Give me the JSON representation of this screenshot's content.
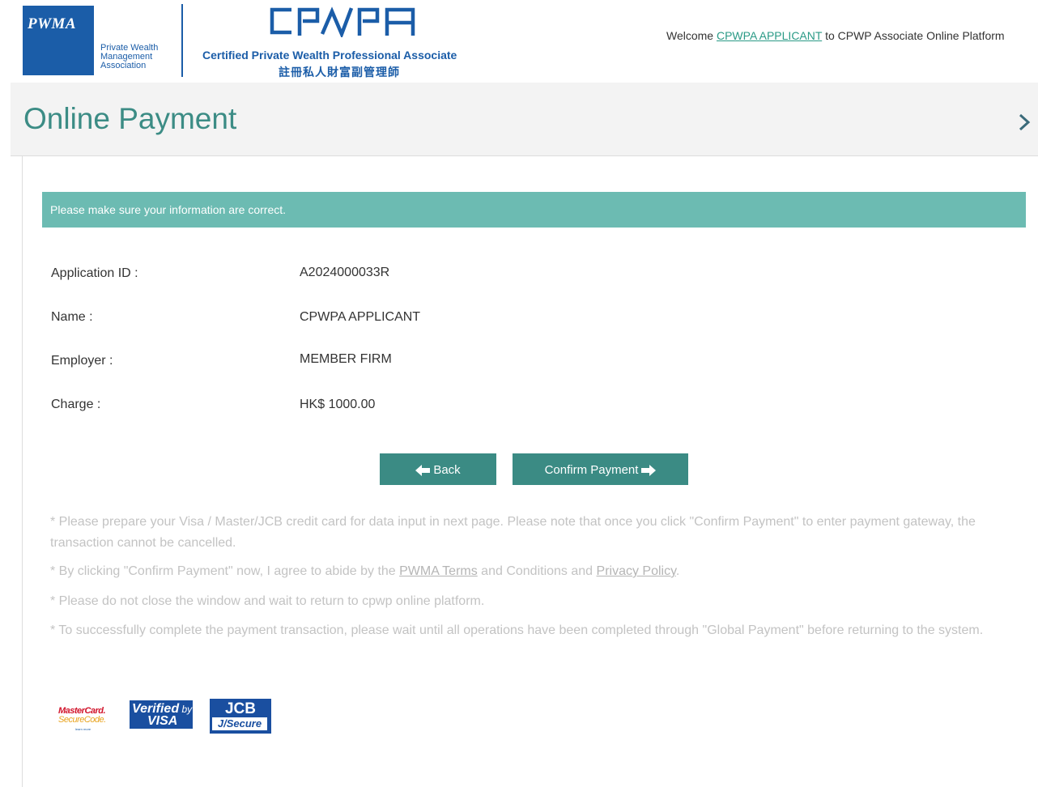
{
  "header": {
    "pwma_logo_text": "PWMA",
    "pwma_sub_1": "Private Wealth",
    "pwma_sub_2": "Management",
    "pwma_sub_3": "Association",
    "cpwpa_logo_text": "CPWPA",
    "cpwpa_title": "Certified Private Wealth Professional Associate",
    "cpwpa_chinese": "註冊私人財富副管理師",
    "welcome_prefix": "Welcome ",
    "welcome_user": "CPWPA APPLICANT",
    "welcome_suffix": " to CPWP Associate Online Platform"
  },
  "page": {
    "title": "Online Payment",
    "notice": "Please make sure your information are correct."
  },
  "details": [
    {
      "label": "Application ID :",
      "value": "A2024000033R"
    },
    {
      "label": "Name :",
      "value": "CPWPA APPLICANT"
    },
    {
      "label": "Employer :",
      "value": "MEMBER FIRM"
    },
    {
      "label": "Charge :",
      "value": "HK$ 1000.00"
    }
  ],
  "buttons": {
    "back": "Back",
    "confirm": "Confirm Payment"
  },
  "notes": {
    "n1": "* Please prepare your Visa / Master/JCB credit card for data input in next page. Please note that once you click \"Confirm Payment\" to enter payment gateway, the transaction cannot be cancelled.",
    "n2_prefix": "* By clicking \"Confirm Payment\" now, I agree to abide by the ",
    "n2_link1": "PWMA Terms",
    "n2_mid": " and Conditions and ",
    "n2_link2": "Privacy Policy",
    "n2_suffix": ".",
    "n3": "* Please do not close the window and wait to return to cpwp online platform.",
    "n4": "* To successfully complete the payment transaction, please wait until all operations have been completed through \"Global Payment\" before returning to the system."
  },
  "card_logos": {
    "mastercard_1": "MasterCard.",
    "mastercard_2": "SecureCode.",
    "mastercard_3": "learn more",
    "visa_1": "Verified",
    "visa_by": "by",
    "visa_2": "VISA",
    "jcb_1": "JCB",
    "jcb_2": "J/Secure"
  },
  "colors": {
    "brand_blue": "#1b5da8",
    "teal": "#3b8b84",
    "notice_bg": "#6cbbb2",
    "title_color": "#3c8c85"
  }
}
